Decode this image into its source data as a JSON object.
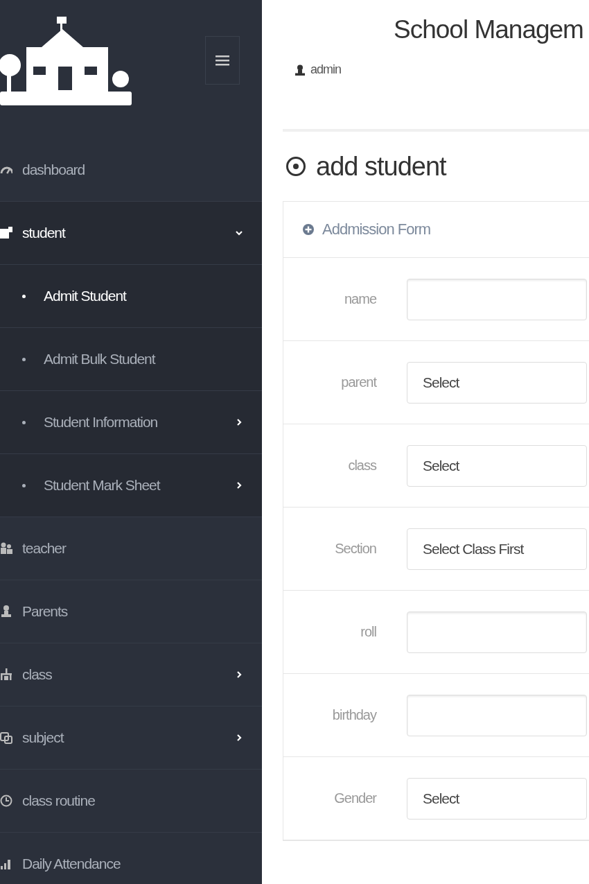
{
  "sidebar": {
    "menu": [
      {
        "label": "dashboard",
        "submenu": false
      },
      {
        "label": "student",
        "submenu": true,
        "expanded": true,
        "children": [
          {
            "label": "Admit Student",
            "selected": true,
            "submenu": false
          },
          {
            "label": "Admit Bulk Student",
            "selected": false,
            "submenu": false
          },
          {
            "label": "Student Information",
            "selected": false,
            "submenu": true
          },
          {
            "label": "Student Mark Sheet",
            "selected": false,
            "submenu": true
          }
        ]
      },
      {
        "label": "teacher",
        "submenu": false
      },
      {
        "label": "Parents",
        "submenu": false
      },
      {
        "label": "class",
        "submenu": true,
        "expanded": false
      },
      {
        "label": "subject",
        "submenu": true,
        "expanded": false
      },
      {
        "label": "class routine",
        "submenu": false
      },
      {
        "label": "Daily Attendance",
        "submenu": false
      }
    ]
  },
  "header": {
    "title": "School Managem",
    "user": "admin"
  },
  "page_title": "add student",
  "panel": {
    "title": "Addmission Form",
    "fields": [
      {
        "label": "name",
        "kind": "text"
      },
      {
        "label": "parent",
        "kind": "select",
        "value": "Select"
      },
      {
        "label": "class",
        "kind": "select",
        "value": "Select"
      },
      {
        "label": "Section",
        "kind": "select",
        "value": "Select Class First"
      },
      {
        "label": "roll",
        "kind": "text"
      },
      {
        "label": "birthday",
        "kind": "text"
      },
      {
        "label": "Gender",
        "kind": "select",
        "value": "Select"
      }
    ]
  }
}
